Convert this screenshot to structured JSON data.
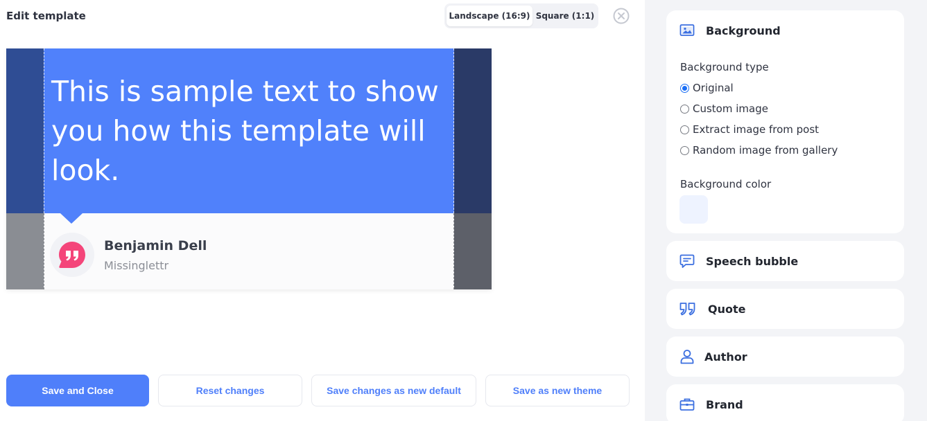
{
  "header": {
    "title": "Edit template",
    "aspect_options": [
      {
        "label": "Landscape (16:9)",
        "active": true
      },
      {
        "label": "Square (1:1)",
        "active": false
      }
    ]
  },
  "preview": {
    "quote_text": "This is sample text to show you how this template will look.",
    "author_name": "Benjamin Dell",
    "author_subtitle": "Missinglettr",
    "colors": {
      "bubble": "#5081fb",
      "background_dark": "#2f4d94",
      "card": "#fbfbfc",
      "logo": "#f4457a"
    }
  },
  "actions": {
    "save_close": "Save and Close",
    "reset": "Reset changes",
    "save_default": "Save changes as new default",
    "save_theme": "Save as new theme"
  },
  "sidebar": {
    "background": {
      "title": "Background",
      "type_label": "Background type",
      "options": [
        "Original",
        "Custom image",
        "Extract image from post",
        "Random image from gallery"
      ],
      "selected": "Original",
      "color_label": "Background color",
      "color_value": "#eef3ff"
    },
    "sections": [
      {
        "title": "Speech bubble",
        "icon": "speech-bubble-icon"
      },
      {
        "title": "Quote",
        "icon": "quote-icon"
      },
      {
        "title": "Author",
        "icon": "user-icon"
      },
      {
        "title": "Brand",
        "icon": "briefcase-icon"
      }
    ]
  },
  "theme": {
    "accent": "#4f7ffa",
    "panel_bg": "#f3f4f7"
  }
}
